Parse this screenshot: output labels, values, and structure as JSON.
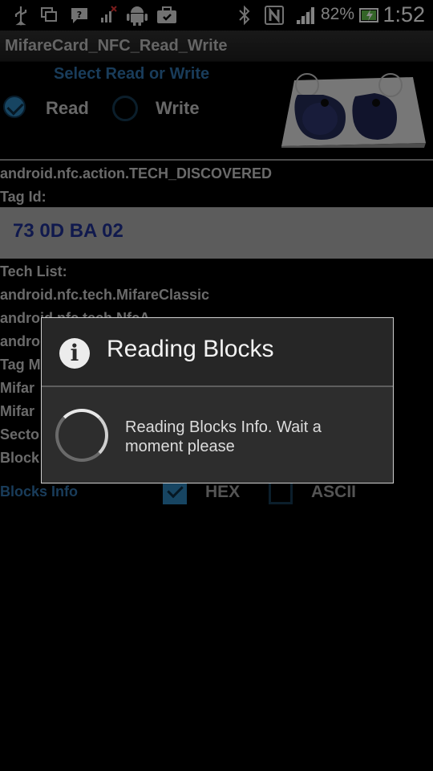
{
  "status_bar": {
    "battery_percent": "82%",
    "time": "1:52",
    "icons": [
      "usb-icon",
      "screenshot-icon",
      "message-icon",
      "signal-debug-icon",
      "android-icon",
      "briefcase-icon",
      "bluetooth-icon",
      "nfc-icon",
      "signal-icon",
      "battery-icon"
    ]
  },
  "app": {
    "title": "MifareCard_NFC_Read_Write"
  },
  "mode": {
    "prompt": "Select Read or Write",
    "read_label": "Read",
    "write_label": "Write",
    "selected": "Read"
  },
  "info": {
    "action": "android.nfc.action.TECH_DISCOVERED",
    "tag_id_label": "Tag Id:",
    "tag_id": "73 0D BA 02",
    "tech_list_label": "Tech List:",
    "tech_1": "android.nfc.tech.MifareClassic",
    "tech_2": "android.nfc.tech.NfcA",
    "partial_1": "andro",
    "partial_2": "Tag M",
    "partial_3": "Mifar",
    "partial_4": "Mifar",
    "partial_5": "Secto",
    "partial_6": "Block"
  },
  "blocks": {
    "label": "Blocks Info",
    "hex_label": "HEX",
    "ascii_label": "ASCII",
    "hex_checked": true,
    "ascii_checked": false
  },
  "dialog": {
    "title": "Reading Blocks",
    "message": "Reading Blocks Info. Wait a moment please"
  }
}
